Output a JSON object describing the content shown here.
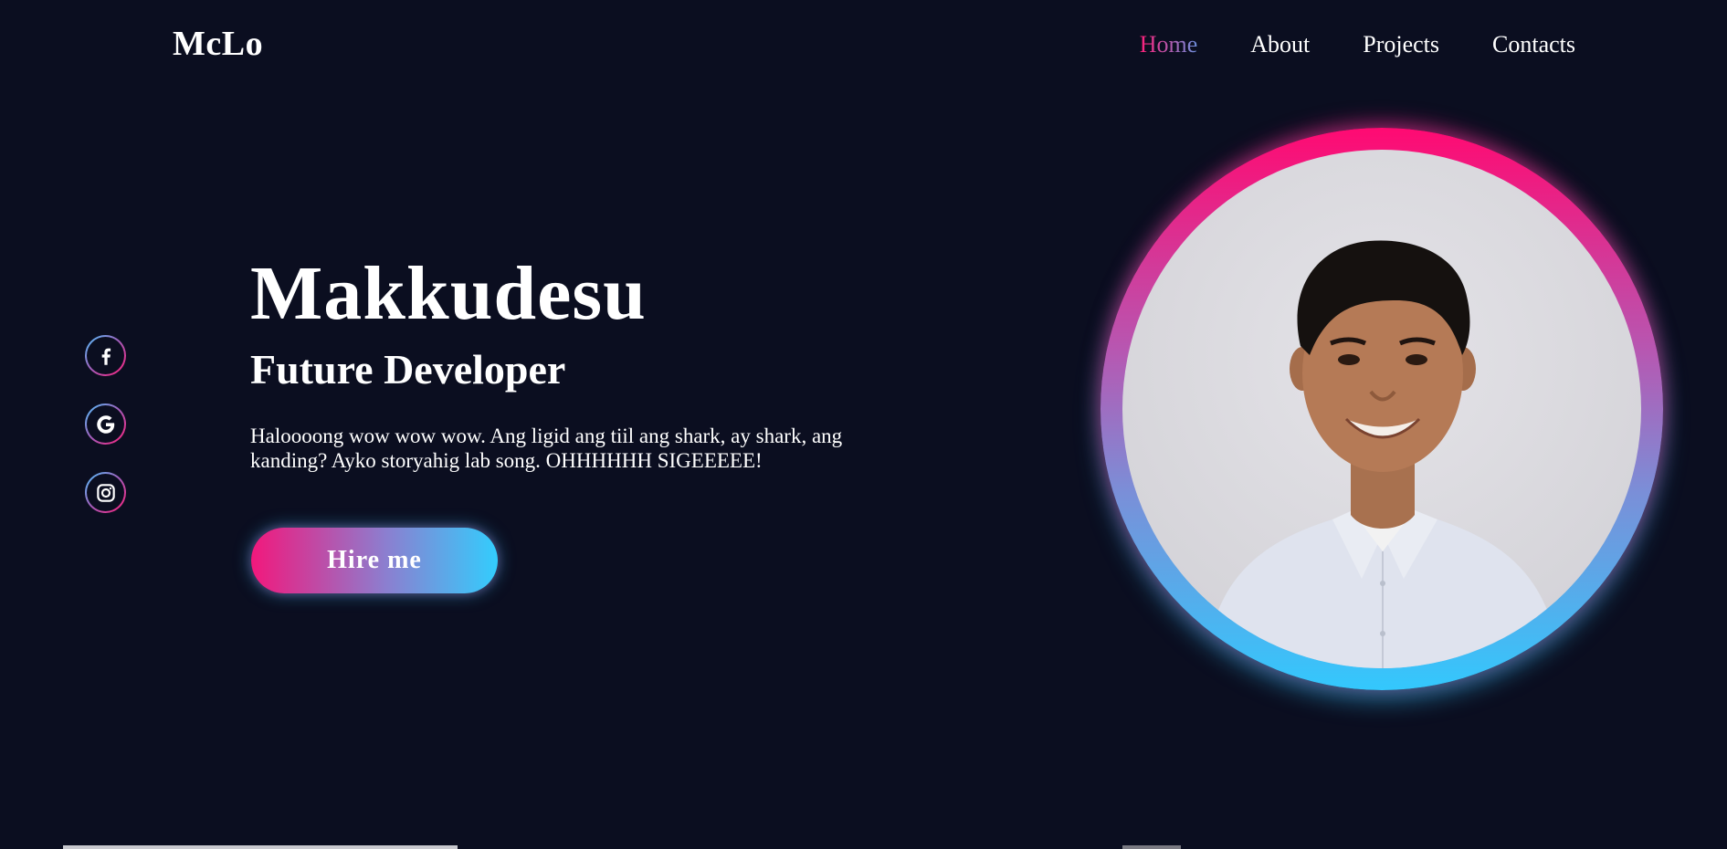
{
  "header": {
    "logo": "McLo",
    "nav": [
      {
        "label": "Home",
        "active": true
      },
      {
        "label": "About",
        "active": false
      },
      {
        "label": "Projects",
        "active": false
      },
      {
        "label": "Contacts",
        "active": false
      }
    ]
  },
  "socials": [
    {
      "icon": "facebook-icon"
    },
    {
      "icon": "google-icon"
    },
    {
      "icon": "instagram-icon"
    }
  ],
  "hero": {
    "name": "Makkudesu",
    "role": "Future Developer",
    "description": "Haloooong wow wow wow. Ang ligid ang tiil ang shark, ay shark, ang kanding? Ayko storyahig lab song. OHHHHHH SIGEEEEE!",
    "button_label": "Hire me"
  },
  "colors": {
    "background": "#0b0e20",
    "accent_pink": "#ff0a72",
    "accent_cyan": "#33c8fd"
  }
}
